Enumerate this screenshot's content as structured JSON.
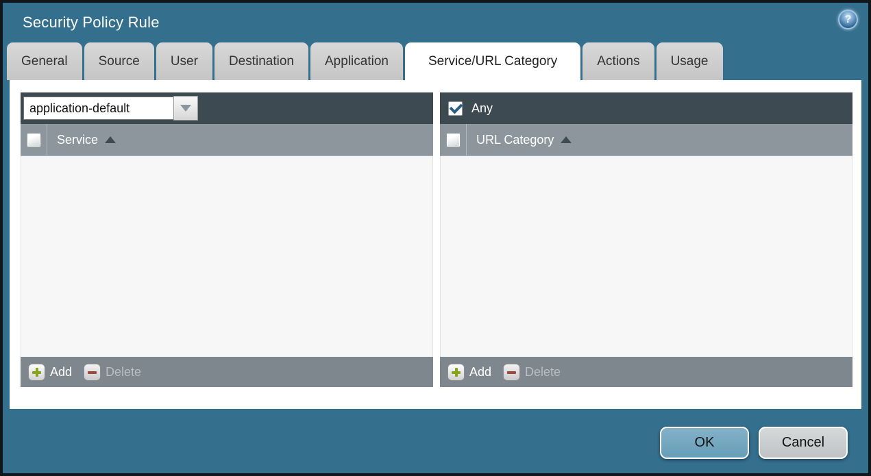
{
  "window": {
    "title": "Security Policy Rule"
  },
  "tabs": [
    {
      "label": "General"
    },
    {
      "label": "Source"
    },
    {
      "label": "User"
    },
    {
      "label": "Destination"
    },
    {
      "label": "Application"
    },
    {
      "label": "Service/URL Category"
    },
    {
      "label": "Actions"
    },
    {
      "label": "Usage"
    }
  ],
  "active_tab": "Service/URL Category",
  "service_panel": {
    "service_select": {
      "value": "application-default"
    },
    "header": {
      "label": "Service",
      "sort_direction": "ascending"
    },
    "add_label": "Add",
    "delete_label": "Delete",
    "rows": []
  },
  "url_panel": {
    "any_checkbox": {
      "label": "Any",
      "checked": true
    },
    "header": {
      "label": "URL Category",
      "sort_direction": "ascending"
    },
    "add_label": "Add",
    "delete_label": "Delete",
    "rows": []
  },
  "dialog_buttons": {
    "ok": "OK",
    "cancel": "Cancel"
  },
  "colors": {
    "titlebar_teal": "#346f8e",
    "toolbar_dark": "#3d4a52",
    "header_gray": "#8d969c",
    "footer_gray": "#7e878d",
    "ok_button": "#74a7c0",
    "add_plus_green": "#87a41f",
    "delete_minus_red": "#9b4a40",
    "check_blue": "#2b5f80"
  }
}
